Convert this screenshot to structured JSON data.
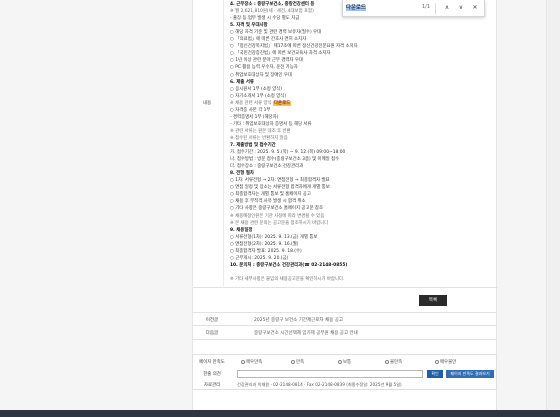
{
  "find_bar": {
    "query": "다운로드",
    "count": "1/1",
    "prev_label": "∧",
    "next_label": "∨",
    "close_label": "✕"
  },
  "main": {
    "row_label": "내용",
    "lines": [
      "4. 근무장소 : 중랑구보건소, 중랑건강센터 등",
      "   ※ 월 2,621,810원(세 · 세전, 4대보험 포함)",
      "   - 출장 등 업무 발생 시 수당 별도 지급",
      "5. 자격 및 우대사항",
      "   ○ 해당 자격 기준 및 관련 경력 보유자(필수) 우대",
      "   ○ 「의료법」에 따른 간호사 면허 소지자",
      "   ○ 「정신건강복지법」 제17조에 따른 정신건강전문요원 자격 소지자",
      "   ○ 「국민건강증진법」에 따른 보건교육사 자격 소지자",
      "   ○ 1년 이상 관련 분야 근무 경력자 우대",
      "   ○ PC 활용 능력 우수자, 운전 가능자",
      "   ○ 취업보호대상자 및 장애인 우대",
      "6. 제출 서류",
      "   ○ 응시원서 1부 (소정 양식)",
      "   ○ 자기소개서 1부 (소정 양식)",
      "        ※ 채용 관련 서류 양식 다운로드",
      "   ○ 자격증 사본 각 1부",
      "     - 경력증명서 1부 (해당자)",
      "     - 기타 : 취업보호대상자 증명서 등 해당 서류",
      "        ※ 관련 서류는 원본 대조 후 반환",
      "        ※ 접수된 서류는 반환하지 않음",
      "7. 제출방법 및 접수기간",
      "   가. 접수기간 : 2025. 9. 5.(목) ~ 9. 12.(목) 09:00~18:00",
      "   나. 접수방법 : 방문 접수(중랑구보건소 3층) 및 이메일 접수",
      "   다. 접수장소 : 중랑구보건소 건강관리과",
      "8. 전형 절차",
      "   ○ 1차: 서류전형 → 2차: 면접전형 → 최종합격자 발표",
      "   ○ 면접 일정 및 장소는 서류전형 합격자에게 개별 통보",
      "   ○ 최종합격자는 개별 통보 및 홈페이지 공고",
      "   ○ 채용 후 부적격 사유 발생 시 합격 취소",
      "   ○ 기타 사항은 중랑구보건소 홈페이지 공고문 참조",
      "   ※ 채용예정인원은 기관 사정에 따라 변경될 수 있음",
      "     ※ 본 채용 관련 문의는 공고문을 참조하시기 바랍니다",
      "9. 채용일정",
      "   ○ 서류전형(1차): 2025. 9. 13.(금) 개별 통보",
      "   ○ 면접전형(2차): 2025. 9. 16.(월)",
      "   ○ 최종합격자 발표: 2025. 9. 18.(수)",
      "   ○ 근무개시: 2025. 9. 20.(금)",
      "10. 문의처 : 중랑구보건소 건강관리과(☎ 02-2148-0855)",
      "",
      "※ 기타 세부사항은 붙임의 채용공고문을 확인하시기 바랍니다."
    ],
    "highlight_line_index": 14,
    "highlight_text": "다운로드"
  },
  "list_button": "목록",
  "prev_row": {
    "label": "이전글",
    "value": "2025년 중랑구 보건소 기간제근로자 채용 공고"
  },
  "next_row": {
    "label": "다음글",
    "value": "중랑구보건소 시간선택제 임기제 공무원 채용 공고 안내"
  },
  "survey": {
    "satisfaction_label": "페이지 만족도",
    "options": [
      "매우만족",
      "만족",
      "보통",
      "불만족",
      "매우불만"
    ],
    "opinion_label": "한줄 의견",
    "opinion_placeholder": "",
    "confirm_label": "확인",
    "summary_label": "페이지 만족도 결과보기",
    "manager_label": "자료관리",
    "manager_info": "건강관리과 이재원 · 02-2148-0814 · Fax 02-2148-0839 (최종수정일: 2025년 9월 5일)"
  },
  "colors": {
    "side_bg": "#f5f5f5",
    "dark_button": "#2b2b2b",
    "blue_button": "#1f5fa8",
    "footer": "#2e3640",
    "highlight": "#f5c842"
  }
}
